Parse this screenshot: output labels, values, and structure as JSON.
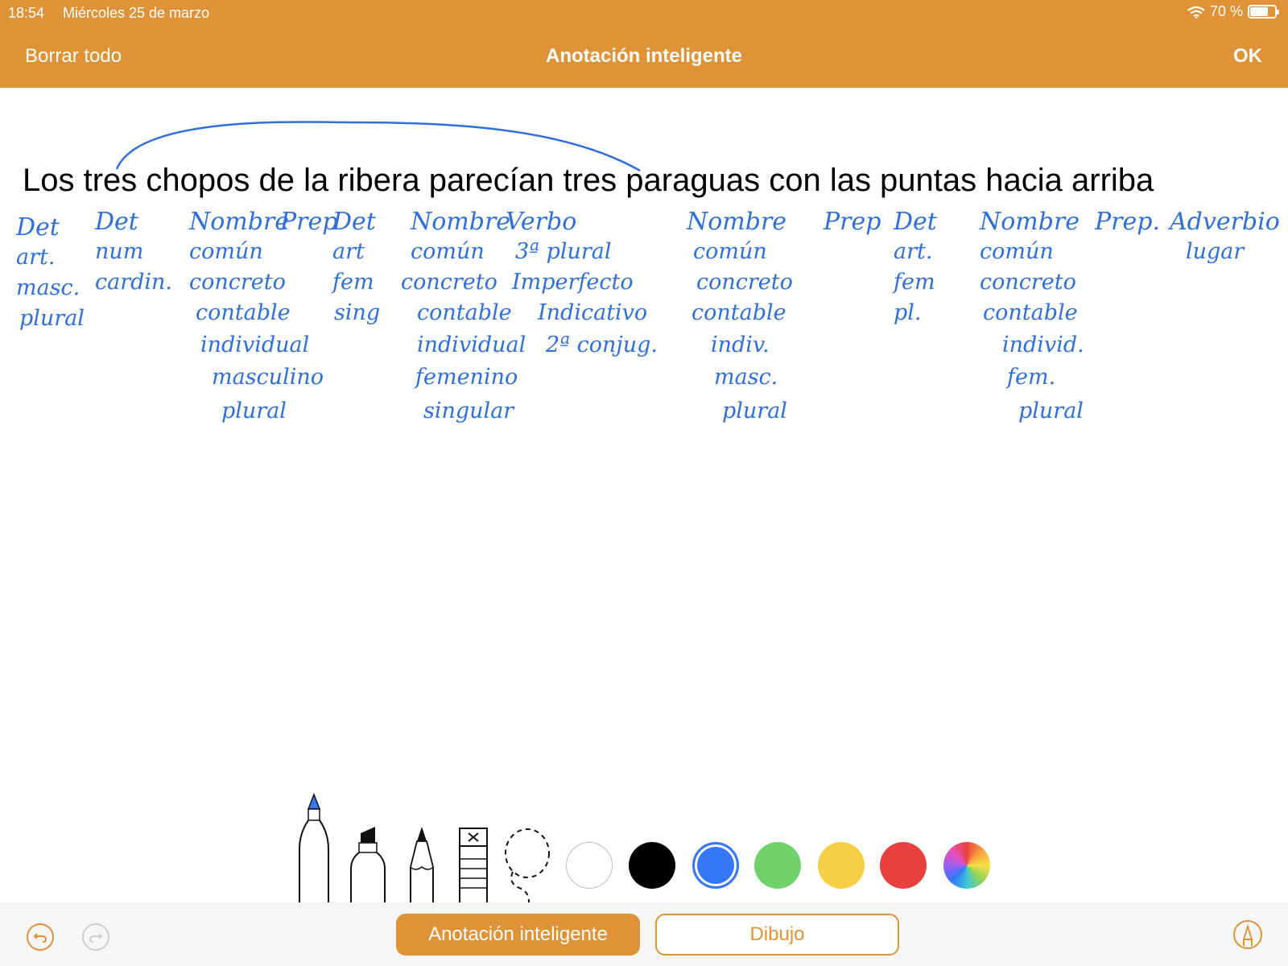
{
  "status": {
    "time": "18:54",
    "date": "Miércoles 25 de marzo",
    "battery": "70 %",
    "battery_level": 0.7,
    "wifi_icon": "wifi-icon"
  },
  "nav": {
    "left": "Borrar todo",
    "title": "Anotación inteligente",
    "right": "OK"
  },
  "document": {
    "sentence": "Los tres chopos de la ribera parecían tres paraguas con las puntas hacia arriba"
  },
  "annotations": [
    [
      "Det",
      "art.",
      "masc.",
      "plural"
    ],
    [
      "Det",
      "num",
      "cardin."
    ],
    [
      "Nombre",
      "común",
      "concreto",
      "contable",
      "individual",
      "masculino",
      "plural"
    ],
    [
      "Prep"
    ],
    [
      "Det",
      "art",
      "fem",
      "sing"
    ],
    [
      "Nombre",
      "común",
      "concreto",
      "contable",
      "individual",
      "femenino",
      "singular"
    ],
    [
      "Verbo",
      "3ª plural",
      "Imperfecto",
      "Indicativo",
      "2ª conjug."
    ],
    [
      "Nombre",
      "común",
      "concreto",
      "contable",
      "indiv.",
      "masc.",
      "plural"
    ],
    [
      "Prep"
    ],
    [
      "Det",
      "art.",
      "fem",
      "pl."
    ],
    [
      "Nombre",
      "común",
      "concreto",
      "contable",
      "individ.",
      "fem.",
      "plural"
    ],
    [
      "Prep."
    ],
    [
      "Adverbio",
      "lugar"
    ]
  ],
  "tools": [
    "pen",
    "marker",
    "pencil",
    "eraser",
    "lasso"
  ],
  "colors": {
    "accent": "#e09336",
    "ink": "#2f6fdb",
    "swatches": [
      "#ffffff",
      "#000000",
      "#3478f6",
      "#6fd36a",
      "#f7cf45",
      "#e8403f"
    ],
    "selected_swatch": 2
  },
  "bottom": {
    "tab_active": "Anotación inteligente",
    "tab_inactive": "Dibujo"
  }
}
